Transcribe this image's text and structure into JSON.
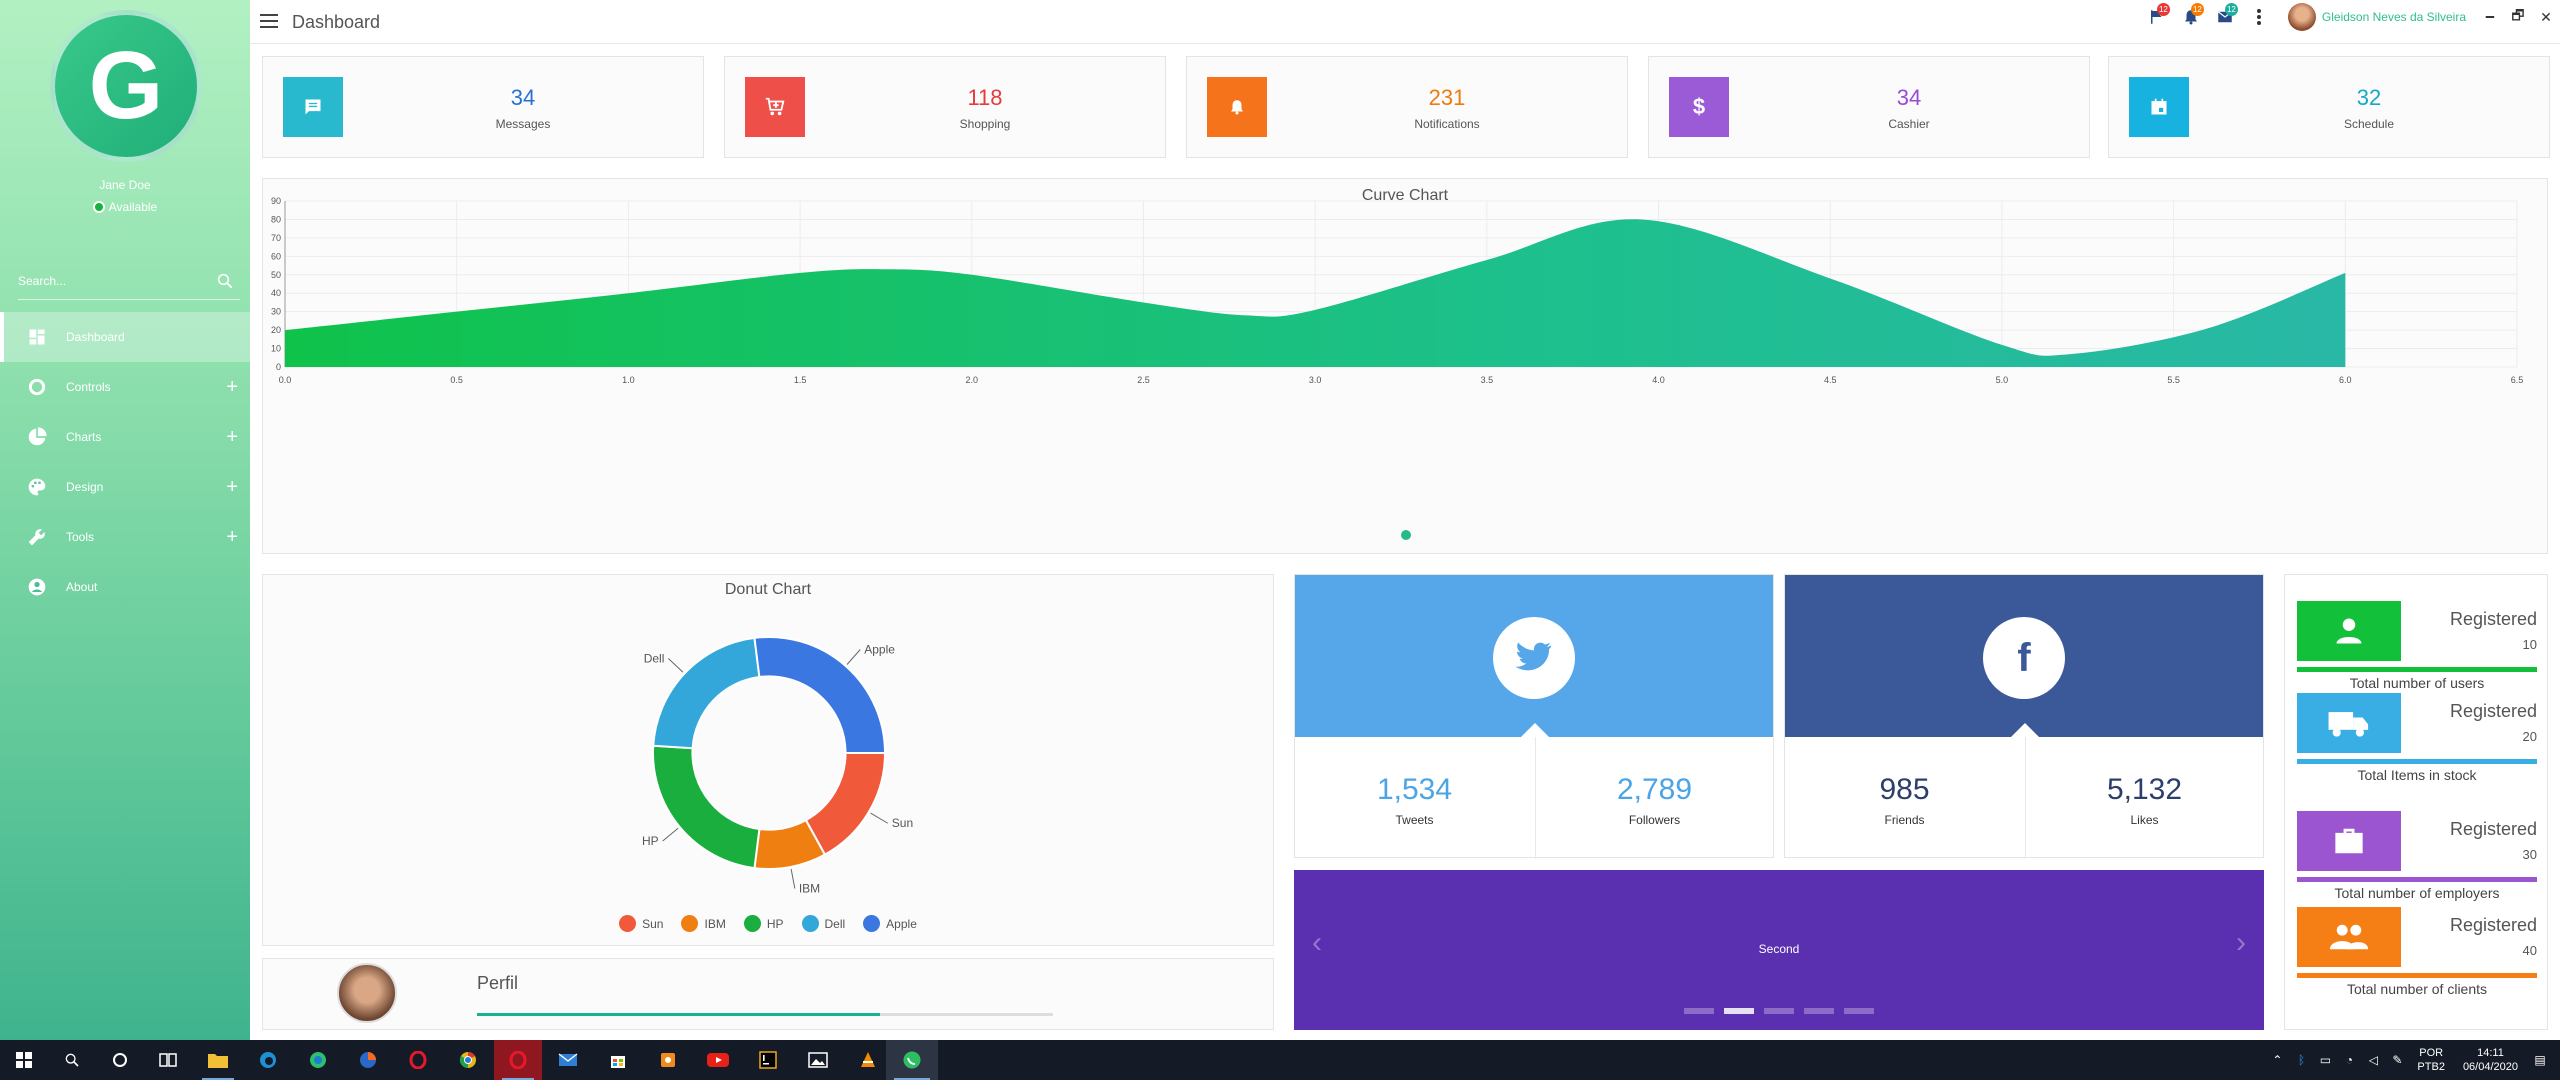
{
  "sidebar": {
    "avatar_letter": "G",
    "user_name": "Jane Doe",
    "status": "Available",
    "search_placeholder": "Search...",
    "items": [
      {
        "label": "Dashboard",
        "icon": "dashboard-icon",
        "active": true
      },
      {
        "label": "Controls",
        "icon": "circle-icon",
        "expandable": true
      },
      {
        "label": "Charts",
        "icon": "pie-chart-icon",
        "expandable": true
      },
      {
        "label": "Design",
        "icon": "palette-icon",
        "expandable": true
      },
      {
        "label": "Tools",
        "icon": "wrench-icon",
        "expandable": true
      },
      {
        "label": "About",
        "icon": "account-circle-icon"
      }
    ]
  },
  "header": {
    "title": "Dashboard",
    "badges": {
      "flag": "12",
      "bell": "12",
      "mail": "12"
    },
    "user_name": "Gleidson Neves da Silveira",
    "window_controls": {
      "minimize": "🗕",
      "restore": "🗗",
      "close": "✕"
    }
  },
  "stats": [
    {
      "value": "34",
      "label": "Messages",
      "icon": "message-icon",
      "color": "#29b9cf",
      "value_color": "#2a6fd6"
    },
    {
      "value": "118",
      "label": "Shopping",
      "icon": "cart-icon",
      "color": "#ee4f49",
      "value_color": "#e63b3b"
    },
    {
      "value": "231",
      "label": "Notifications",
      "icon": "bell-icon",
      "color": "#f5731b",
      "value_color": "#f07a12"
    },
    {
      "value": "34",
      "label": "Cashier",
      "icon": "dollar-icon",
      "color": "#9b5ad6",
      "value_color": "#9b4ad6"
    },
    {
      "value": "32",
      "label": "Schedule",
      "icon": "calendar-icon",
      "color": "#18b2e0",
      "value_color": "#16a8c4"
    }
  ],
  "curve_chart": {
    "title": "Curve Chart",
    "chart_data": {
      "type": "area",
      "x": [
        0.0,
        0.5,
        1.0,
        1.5,
        1.75,
        2.0,
        2.5,
        2.8,
        3.0,
        3.5,
        3.95,
        4.5,
        5.0,
        5.2,
        5.6,
        6.0
      ],
      "y": [
        20,
        30,
        40,
        51,
        53,
        50,
        35,
        28,
        31,
        58,
        80,
        48,
        12,
        7,
        21,
        51
      ],
      "xlim": [
        0.0,
        6.5
      ],
      "ylim": [
        0,
        90
      ],
      "xticks": [
        "0.0",
        "0.5",
        "1.0",
        "1.5",
        "2.0",
        "2.5",
        "3.0",
        "3.5",
        "4.0",
        "4.5",
        "5.0",
        "5.5",
        "6.0",
        "6.5"
      ],
      "yticks": [
        "0",
        "10",
        "20",
        "30",
        "40",
        "50",
        "60",
        "70",
        "80",
        "90"
      ],
      "grid": true,
      "legend": "bottom"
    }
  },
  "donut_chart": {
    "title": "Donut Chart",
    "chart_data": {
      "type": "pie",
      "hole": 0.66,
      "categories": [
        "Sun",
        "IBM",
        "HP",
        "Dell",
        "Apple"
      ],
      "values": [
        17,
        10,
        24,
        22,
        27
      ],
      "colors": [
        "#f05a3a",
        "#f07f12",
        "#19ae3e",
        "#33a6da",
        "#3b77e0"
      ],
      "legend": "bottom"
    }
  },
  "profile": {
    "title": "Perfil",
    "progress": 0.7
  },
  "twitter": {
    "tweets": "1,534",
    "tweets_label": "Tweets",
    "followers": "2,789",
    "followers_label": "Followers",
    "color": "#55a7e9",
    "value_color": "#4aa4e6"
  },
  "facebook": {
    "friends": "985",
    "friends_label": "Friends",
    "likes": "5,132",
    "likes_label": "Likes",
    "color": "#3b5898",
    "value_color": "#2c3f6b"
  },
  "carousel": {
    "caption": "Second",
    "active_index": 1,
    "count": 5,
    "prev": "‹",
    "next": "›"
  },
  "registered": [
    {
      "title": "Registered",
      "value": "10",
      "desc": "Total number of users",
      "color": "#13c03a",
      "icon": "person-icon"
    },
    {
      "title": "Registered",
      "value": "20",
      "desc": "Total Items in stock",
      "color": "#39aee4",
      "icon": "truck-icon"
    },
    {
      "title": "Registered",
      "value": "30",
      "desc": "Total number of employers",
      "color": "#9b55d1",
      "icon": "briefcase-icon"
    },
    {
      "title": "Registered",
      "value": "40",
      "desc": "Total number of clients",
      "color": "#f57f14",
      "icon": "group-icon"
    }
  ],
  "taskbar": {
    "language": "POR",
    "layout": "PTB2",
    "time": "14:11",
    "date": "06/04/2020"
  }
}
